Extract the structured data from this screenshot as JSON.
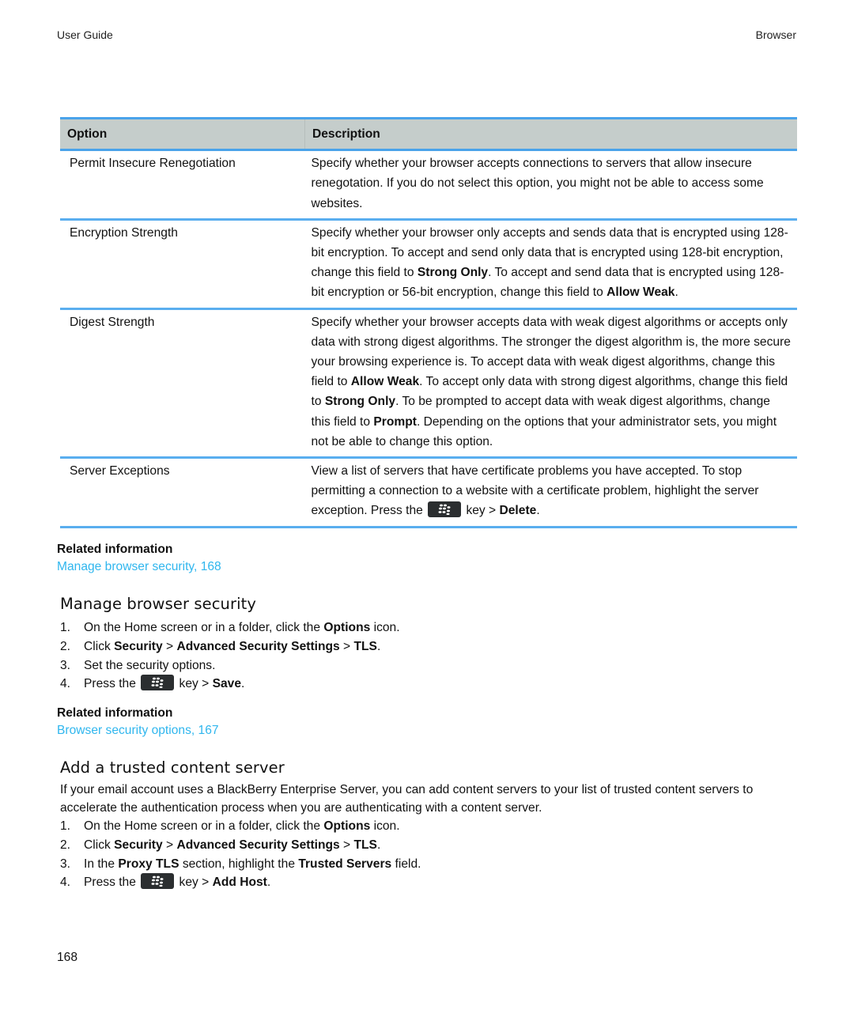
{
  "running_head": {
    "left": "User Guide",
    "right": "Browser"
  },
  "table": {
    "headers": [
      "Option",
      "Description"
    ],
    "rows": [
      {
        "option": "Permit Insecure Renegotiation",
        "description": [
          {
            "t": "Specify whether your browser accepts connections to servers that allow insecure renegotation. If you do not select this option, you might not be able to access some websites."
          }
        ]
      },
      {
        "option": "Encryption Strength",
        "description": [
          {
            "t": "Specify whether your browser only accepts and sends data that is encrypted using 128-bit encryption. To accept and send only data that is encrypted using 128-bit encryption, change this field to "
          },
          {
            "b": "Strong Only"
          },
          {
            "t": ". To accept and send data that is encrypted using 128-bit encryption or 56-bit encryption, change this field to "
          },
          {
            "b": "Allow Weak"
          },
          {
            "t": "."
          }
        ]
      },
      {
        "option": "Digest Strength",
        "description": [
          {
            "t": "Specify whether your browser accepts data with weak digest algorithms or accepts only data with strong digest algorithms. The stronger the digest algorithm is, the more secure your browsing experience is. To accept data with weak digest algorithms, change this field to "
          },
          {
            "b": "Allow Weak"
          },
          {
            "t": ". To accept only data with strong digest algorithms, change this field to "
          },
          {
            "b": "Strong Only"
          },
          {
            "t": ". To be prompted to accept data with weak digest algorithms, change this field to "
          },
          {
            "b": "Prompt"
          },
          {
            "t": ". Depending on the options that your administrator sets, you might not be able to change this option."
          }
        ]
      },
      {
        "option": "Server Exceptions",
        "description": [
          {
            "t": "View a list of servers that have certificate problems you have accepted. To stop permitting a connection to a website with a certificate problem, highlight the server exception. Press the "
          },
          {
            "key": "blackberry-menu-key"
          },
          {
            "t": " key > "
          },
          {
            "b": "Delete"
          },
          {
            "t": "."
          }
        ]
      }
    ]
  },
  "related_1": {
    "title": "Related information",
    "link": "Manage browser security, 168"
  },
  "section_manage": {
    "title": "Manage browser security",
    "steps": [
      [
        {
          "t": "On the Home screen or in a folder, click the "
        },
        {
          "b": "Options"
        },
        {
          "t": " icon."
        }
      ],
      [
        {
          "t": "Click "
        },
        {
          "b": "Security"
        },
        {
          "t": " > "
        },
        {
          "b": "Advanced Security Settings"
        },
        {
          "t": " > "
        },
        {
          "b": "TLS"
        },
        {
          "t": "."
        }
      ],
      [
        {
          "t": "Set the security options."
        }
      ],
      [
        {
          "t": "Press the "
        },
        {
          "key": "blackberry-menu-key"
        },
        {
          "t": " key > "
        },
        {
          "b": "Save"
        },
        {
          "t": "."
        }
      ]
    ]
  },
  "related_2": {
    "title": "Related information",
    "link": "Browser security options, 167"
  },
  "section_trusted": {
    "title": "Add a trusted content server",
    "intro": "If your email account uses a BlackBerry Enterprise Server, you can add content servers to your list of trusted content servers to accelerate the authentication process when you are authenticating with a content server.",
    "steps": [
      [
        {
          "t": "On the Home screen or in a folder, click the "
        },
        {
          "b": "Options"
        },
        {
          "t": " icon."
        }
      ],
      [
        {
          "t": "Click "
        },
        {
          "b": "Security"
        },
        {
          "t": " > "
        },
        {
          "b": "Advanced Security Settings"
        },
        {
          "t": " > "
        },
        {
          "b": "TLS"
        },
        {
          "t": "."
        }
      ],
      [
        {
          "t": "In the "
        },
        {
          "b": "Proxy TLS"
        },
        {
          "t": " section, highlight the "
        },
        {
          "b": "Trusted Servers"
        },
        {
          "t": " field."
        }
      ],
      [
        {
          "t": "Press the "
        },
        {
          "key": "blackberry-menu-key"
        },
        {
          "t": " key > "
        },
        {
          "b": "Add Host"
        },
        {
          "t": "."
        }
      ]
    ]
  },
  "page_number": "168",
  "colors": {
    "link": "#2fb6ee",
    "table_rule": "#5aaeef",
    "header_fill": "#c5cdcb",
    "key_fill": "#2b2e30"
  }
}
